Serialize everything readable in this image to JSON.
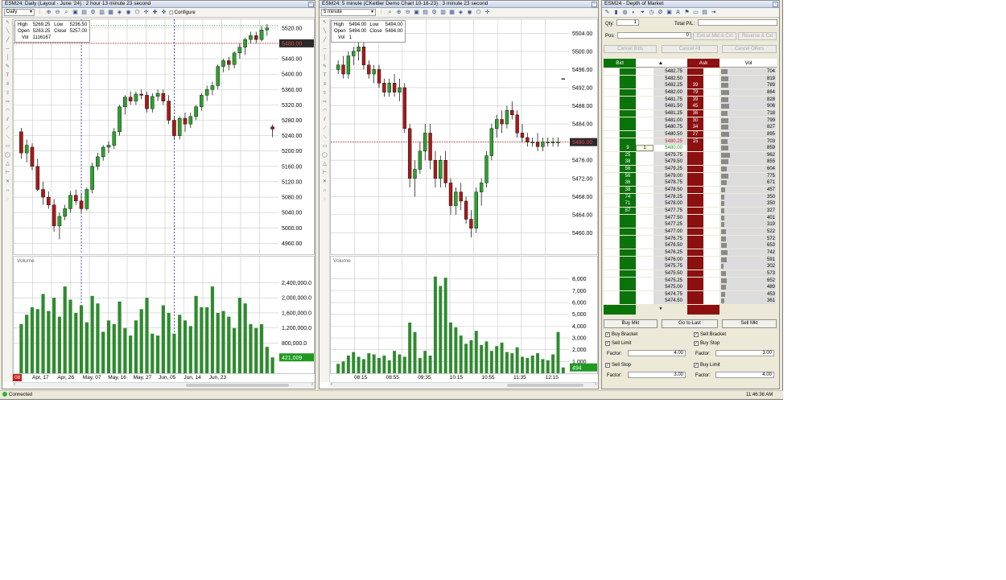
{
  "colors": {
    "bull": "#2ea12e",
    "bear": "#a81a1a",
    "vol": "#2e8b2e",
    "bid": "#0a730a",
    "ask": "#8c1010",
    "last": "#a81a1a",
    "grid": "#c9c9c9"
  },
  "daily": {
    "title": "ESM24: Daily (Layout - June '24) : 2 hour 13 minute 23 second",
    "interval": "Daily",
    "configure": "Configure",
    "info": {
      "h": "High",
      "hv": "5269.25",
      "l": "Low",
      "lv": "5236.50",
      "o": "Open",
      "ov": "5263.25",
      "c": "Close",
      "cv": "5257.00",
      "v": "Vol",
      "vv": "1116167"
    },
    "price_ticks": [
      "5520.00",
      "5480.00",
      "5440.00",
      "5400.00",
      "5360.00",
      "5320.00",
      "5280.00",
      "5240.00",
      "5200.00",
      "5160.00",
      "5120.00",
      "5080.00",
      "5040.00",
      "5000.00",
      "4960.00"
    ],
    "last_price": "5480.00",
    "volume_label": "Volume",
    "vol_ticks": [
      "2,400,000.0",
      "2,000,000.0",
      "1,600,000.0",
      "1,200,000.0",
      "800,000.0"
    ],
    "last_vol": "421,009",
    "x_first": "08",
    "x_ticks": [
      "Apr, 17",
      "Apr, 26",
      "May, 07",
      "May, 16",
      "May, 27",
      "Jun, 05",
      "Jun, 14",
      "Jun, 23"
    ]
  },
  "intraday": {
    "title": "ESM24: 5 minute (CKettler Demo Chart 10-18-23) : 3 minute 23 second",
    "interval": "5 minute",
    "info": {
      "h": "High",
      "hv": "5494.00",
      "l": "Low",
      "lv": "5494.00",
      "o": "Open",
      "ov": "5494.00",
      "c": "Close",
      "cv": "5494.00",
      "v": "Vol",
      "vv": "1"
    },
    "price_ticks": [
      "5504.00",
      "5500.00",
      "5496.00",
      "5492.00",
      "5488.00",
      "5484.00",
      "5480.00",
      "5476.00",
      "5472.00",
      "5468.00",
      "5464.00",
      "5460.00"
    ],
    "last_price": "5480.00",
    "volume_label": "Volume",
    "vol_ticks": [
      "8,000",
      "7,000",
      "6,000",
      "5,000",
      "4,000",
      "3,000",
      "2,000",
      "1,000"
    ],
    "last_vol": "494",
    "x_ticks": [
      "08:15",
      "08:55",
      "09:35",
      "10:15",
      "10:55",
      "11:35",
      "12:15"
    ]
  },
  "dom": {
    "title": "ESM24 - Depth of Market",
    "qty_label": "Qty:",
    "qty": "1",
    "pnl_label": "Total P/L:",
    "pos_label": "Pos:",
    "pos": "0",
    "exit_btn": "Exit at Mkt & Cxl",
    "reverse_btn": "Reverse & Cxl",
    "cancel_bids": "Cancel Bids",
    "cancel_all": "Cancel All",
    "cancel_offers": "Cancel Offers",
    "col_bid": "Bid",
    "col_ask": "Ask",
    "col_vol": "Vol",
    "rows": [
      {
        "price": "5482.75",
        "bid": "",
        "ask": "",
        "vol": "704",
        "vbar": 0.35
      },
      {
        "price": "5482.50",
        "bid": "",
        "ask": "",
        "vol": "819",
        "vbar": 0.41
      },
      {
        "price": "5482.25",
        "bid": "",
        "ask": "39",
        "vol": "789",
        "vbar": 0.4
      },
      {
        "price": "5482.00",
        "bid": "",
        "ask": "79",
        "vol": "864",
        "vbar": 0.44
      },
      {
        "price": "5481.75",
        "bid": "",
        "ask": "39",
        "vol": "828",
        "vbar": 0.42
      },
      {
        "price": "5481.50",
        "bid": "",
        "ask": "45",
        "vol": "906",
        "vbar": 0.46
      },
      {
        "price": "5481.25",
        "bid": "",
        "ask": "36",
        "vol": "718",
        "vbar": 0.36
      },
      {
        "price": "5481.00",
        "bid": "",
        "ask": "30",
        "vol": "799",
        "vbar": 0.4
      },
      {
        "price": "5480.75",
        "bid": "",
        "ask": "34",
        "vol": "827",
        "vbar": 0.42
      },
      {
        "price": "5480.50",
        "bid": "",
        "ask": "27",
        "vol": "895",
        "vbar": 0.45
      },
      {
        "price": "5480.25",
        "bid": "",
        "ask": "15",
        "vol": "703",
        "vbar": 0.35,
        "hl": "red"
      },
      {
        "price": "5480.00",
        "bid": "9",
        "ask": "",
        "vol": "859",
        "vbar": 0.43,
        "hl": "green",
        "pos": "1"
      },
      {
        "price": "5479.75",
        "bid": "25",
        "ask": "",
        "vol": "962",
        "vbar": 0.49
      },
      {
        "price": "5479.50",
        "bid": "38",
        "ask": "",
        "vol": "855",
        "vbar": 0.43
      },
      {
        "price": "5479.25",
        "bid": "56",
        "ask": "",
        "vol": "604",
        "vbar": 0.3
      },
      {
        "price": "5479.00",
        "bid": "56",
        "ask": "",
        "vol": "775",
        "vbar": 0.39
      },
      {
        "price": "5478.75",
        "bid": "36",
        "ask": "",
        "vol": "671",
        "vbar": 0.34
      },
      {
        "price": "5478.50",
        "bid": "38",
        "ask": "",
        "vol": "457",
        "vbar": 0.23
      },
      {
        "price": "5478.25",
        "bid": "74",
        "ask": "",
        "vol": "350",
        "vbar": 0.18
      },
      {
        "price": "5478.00",
        "bid": "71",
        "ask": "",
        "vol": "350",
        "vbar": 0.18
      },
      {
        "price": "5477.75",
        "bid": "87",
        "ask": "",
        "vol": "327",
        "vbar": 0.16
      },
      {
        "price": "5477.50",
        "bid": "",
        "ask": "",
        "vol": "401",
        "vbar": 0.2
      },
      {
        "price": "5477.25",
        "bid": "",
        "ask": "",
        "vol": "319",
        "vbar": 0.16
      },
      {
        "price": "5477.00",
        "bid": "",
        "ask": "",
        "vol": "522",
        "vbar": 0.26
      },
      {
        "price": "5476.75",
        "bid": "",
        "ask": "",
        "vol": "572",
        "vbar": 0.29
      },
      {
        "price": "5476.50",
        "bid": "",
        "ask": "",
        "vol": "653",
        "vbar": 0.33
      },
      {
        "price": "5476.25",
        "bid": "",
        "ask": "",
        "vol": "742",
        "vbar": 0.37
      },
      {
        "price": "5476.00",
        "bid": "",
        "ask": "",
        "vol": "591",
        "vbar": 0.3
      },
      {
        "price": "5475.75",
        "bid": "",
        "ask": "",
        "vol": "302",
        "vbar": 0.15
      },
      {
        "price": "5475.50",
        "bid": "",
        "ask": "",
        "vol": "573",
        "vbar": 0.29
      },
      {
        "price": "5475.25",
        "bid": "",
        "ask": "",
        "vol": "652",
        "vbar": 0.33
      },
      {
        "price": "5475.00",
        "bid": "",
        "ask": "",
        "vol": "489",
        "vbar": 0.25
      },
      {
        "price": "5474.75",
        "bid": "",
        "ask": "",
        "vol": "453",
        "vbar": 0.23
      },
      {
        "price": "5474.50",
        "bid": "",
        "ask": "",
        "vol": "361",
        "vbar": 0.18
      }
    ],
    "buy_mkt": "Buy Mkt",
    "go_last": "Go to Last",
    "sell_mkt": "Sell Mkt",
    "buy_bracket": "Buy Bracket",
    "sell_bracket": "Sell Bracket",
    "sell_limit": "Sell Limit",
    "buy_stop": "Buy Stop",
    "factor_label": "Factor:",
    "f1": "4.00",
    "f2": "3.00",
    "sell_stop": "Sell Stop",
    "buy_limit": "Buy Limit",
    "f3": "3.00",
    "f4": "4.00"
  },
  "status": {
    "connected": "Connected",
    "time": "11:46:36 AM"
  },
  "chart_data": [
    {
      "type": "candlestick",
      "title": "ESM24: Daily (Layout - June '24)",
      "ylim": [
        4940,
        5530
      ],
      "x": [
        "Apr, 15",
        "Apr, 16",
        "Apr, 17",
        "Apr, 18",
        "Apr, 19",
        "Apr, 22",
        "Apr, 23",
        "Apr, 24",
        "Apr, 25",
        "Apr, 26",
        "Apr, 29",
        "Apr, 30",
        "May, 01",
        "May, 02",
        "May, 03",
        "May, 06",
        "May, 07",
        "May, 08",
        "May, 09",
        "May, 10",
        "May, 13",
        "May, 14",
        "May, 15",
        "May, 16",
        "May, 17",
        "May, 20",
        "May, 21",
        "May, 22",
        "May, 23",
        "May, 24",
        "May, 28",
        "May, 29",
        "May, 30",
        "May, 31",
        "Jun, 03",
        "Jun, 04",
        "Jun, 05",
        "Jun, 06",
        "Jun, 07",
        "Jun, 10",
        "Jun, 11",
        "Jun, 12",
        "Jun, 13",
        "Jun, 14",
        "Jun, 17",
        "Jun, 18",
        "Jun, 19"
      ],
      "ohlc": [
        [
          5250,
          5260,
          5180,
          5195
        ],
        [
          5195,
          5230,
          5170,
          5215
        ],
        [
          5210,
          5220,
          5150,
          5160
        ],
        [
          5160,
          5180,
          5095,
          5100
        ],
        [
          5100,
          5120,
          5060,
          5080
        ],
        [
          5080,
          5095,
          5050,
          5060
        ],
        [
          5060,
          5075,
          4990,
          5005
        ],
        [
          5005,
          5040,
          4970,
          5030
        ],
        [
          5030,
          5060,
          5020,
          5050
        ],
        [
          5050,
          5095,
          5040,
          5085
        ],
        [
          5085,
          5100,
          5060,
          5070
        ],
        [
          5070,
          5090,
          5040,
          5050
        ],
        [
          5050,
          5105,
          5045,
          5100
        ],
        [
          5100,
          5170,
          5090,
          5160
        ],
        [
          5160,
          5195,
          5150,
          5185
        ],
        [
          5185,
          5215,
          5175,
          5210
        ],
        [
          5210,
          5225,
          5195,
          5215
        ],
        [
          5215,
          5260,
          5205,
          5250
        ],
        [
          5250,
          5320,
          5240,
          5315
        ],
        [
          5315,
          5345,
          5295,
          5340
        ],
        [
          5340,
          5355,
          5320,
          5330
        ],
        [
          5330,
          5355,
          5320,
          5348
        ],
        [
          5348,
          5360,
          5335,
          5345
        ],
        [
          5345,
          5355,
          5300,
          5310
        ],
        [
          5310,
          5350,
          5300,
          5342
        ],
        [
          5342,
          5360,
          5330,
          5350
        ],
        [
          5350,
          5360,
          5320,
          5330
        ],
        [
          5330,
          5345,
          5270,
          5280
        ],
        [
          5280,
          5290,
          5230,
          5240
        ],
        [
          5240,
          5290,
          5230,
          5285
        ],
        [
          5285,
          5300,
          5250,
          5270
        ],
        [
          5270,
          5300,
          5260,
          5290
        ],
        [
          5290,
          5320,
          5280,
          5315
        ],
        [
          5315,
          5350,
          5305,
          5345
        ],
        [
          5345,
          5370,
          5330,
          5360
        ],
        [
          5360,
          5380,
          5345,
          5370
        ],
        [
          5370,
          5425,
          5360,
          5420
        ],
        [
          5420,
          5440,
          5405,
          5435
        ],
        [
          5435,
          5445,
          5410,
          5425
        ],
        [
          5425,
          5460,
          5415,
          5455
        ],
        [
          5455,
          5480,
          5440,
          5470
        ],
        [
          5470,
          5495,
          5450,
          5490
        ],
        [
          5490,
          5510,
          5480,
          5500
        ],
        [
          5500,
          5510,
          5480,
          5490
        ],
        [
          5490,
          5525,
          5485,
          5515
        ],
        [
          5515,
          5530,
          5500,
          5520
        ],
        [
          5263,
          5269,
          5236,
          5257
        ]
      ],
      "volume": [
        1300000,
        1550000,
        1750000,
        1700000,
        2100000,
        1650000,
        2000000,
        1500000,
        2300000,
        1950000,
        1600000,
        1800000,
        1350000,
        2050000,
        1850000,
        1100000,
        1400000,
        1300000,
        1900000,
        1200000,
        1000000,
        1400000,
        1700000,
        2000000,
        1050000,
        1000000,
        1800000,
        1600000,
        1050000,
        1550000,
        1400000,
        1250000,
        2050000,
        1750000,
        1750000,
        2300000,
        1600000,
        1650000,
        1500000,
        1200000,
        2000000,
        1850000,
        1300000,
        1200000,
        1300000,
        700000,
        421009
      ]
    },
    {
      "type": "candlestick",
      "title": "ESM24: 5 minute (CKettler Demo Chart 10-18-23)",
      "ylim": [
        5456,
        5506
      ],
      "x": [
        "08:00",
        "08:05",
        "08:10",
        "08:15",
        "08:20",
        "08:25",
        "08:30",
        "08:35",
        "08:40",
        "08:45",
        "08:50",
        "08:55",
        "09:00",
        "09:05",
        "09:10",
        "09:15",
        "09:20",
        "09:25",
        "09:30",
        "09:35",
        "09:40",
        "09:45",
        "09:50",
        "09:55",
        "10:00",
        "10:05",
        "10:10",
        "10:15",
        "10:20",
        "10:25",
        "10:30",
        "10:35",
        "10:40",
        "10:45",
        "10:50",
        "10:55",
        "11:00",
        "11:05",
        "11:10",
        "11:15",
        "11:20",
        "11:25",
        "11:30",
        "11:35",
        "11:40"
      ],
      "ohlc": [
        [
          5496,
          5498,
          5495,
          5497
        ],
        [
          5497,
          5499,
          5494,
          5495
        ],
        [
          5495,
          5500,
          5494,
          5499
        ],
        [
          5499,
          5501,
          5497,
          5500
        ],
        [
          5500,
          5502,
          5498,
          5501
        ],
        [
          5501,
          5502,
          5496,
          5497
        ],
        [
          5497,
          5498,
          5494,
          5495
        ],
        [
          5495,
          5497,
          5493,
          5496
        ],
        [
          5496,
          5497,
          5492,
          5493
        ],
        [
          5493,
          5494,
          5490,
          5491
        ],
        [
          5491,
          5494,
          5490,
          5493
        ],
        [
          5493,
          5495,
          5490,
          5491
        ],
        [
          5491,
          5494,
          5489,
          5492
        ],
        [
          5492,
          5493,
          5482,
          5483
        ],
        [
          5483,
          5484,
          5470,
          5472
        ],
        [
          5472,
          5476,
          5468,
          5474
        ],
        [
          5474,
          5480,
          5473,
          5478
        ],
        [
          5478,
          5484,
          5476,
          5482
        ],
        [
          5482,
          5484,
          5474,
          5476
        ],
        [
          5476,
          5478,
          5470,
          5472
        ],
        [
          5472,
          5477,
          5470,
          5476
        ],
        [
          5476,
          5478,
          5470,
          5471
        ],
        [
          5471,
          5472,
          5464,
          5466
        ],
        [
          5466,
          5470,
          5464,
          5469
        ],
        [
          5469,
          5471,
          5465,
          5467
        ],
        [
          5467,
          5468,
          5462,
          5463
        ],
        [
          5463,
          5465,
          5459,
          5461
        ],
        [
          5461,
          5470,
          5460,
          5469
        ],
        [
          5469,
          5472,
          5466,
          5471
        ],
        [
          5471,
          5478,
          5470,
          5477
        ],
        [
          5477,
          5484,
          5476,
          5483
        ],
        [
          5483,
          5486,
          5481,
          5485
        ],
        [
          5485,
          5487,
          5482,
          5484
        ],
        [
          5484,
          5488,
          5483,
          5487
        ],
        [
          5487,
          5489,
          5485,
          5486
        ],
        [
          5486,
          5487,
          5481,
          5482
        ],
        [
          5482,
          5484,
          5480,
          5481
        ],
        [
          5481,
          5482,
          5479,
          5480
        ],
        [
          5480,
          5481,
          5479,
          5480
        ],
        [
          5480,
          5482,
          5478,
          5479
        ],
        [
          5479,
          5481,
          5478,
          5480
        ],
        [
          5480,
          5481,
          5479,
          5480
        ],
        [
          5480,
          5481,
          5479,
          5480
        ],
        [
          5480,
          5481,
          5479,
          5480
        ],
        [
          5494,
          5494,
          5494,
          5494
        ]
      ],
      "volume": [
        800,
        1000,
        1500,
        1800,
        1400,
        1200,
        1700,
        1600,
        1300,
        1500,
        1100,
        1900,
        1600,
        1400,
        4300,
        3500,
        1300,
        1900,
        1500,
        8200,
        7400,
        8100,
        4300,
        3900,
        3200,
        2500,
        2800,
        3600,
        2400,
        2700,
        1900,
        2300,
        2600,
        1800,
        1700,
        2200,
        1400,
        1300,
        1500,
        1700,
        1200,
        1100,
        1600,
        3500,
        494
      ]
    }
  ]
}
